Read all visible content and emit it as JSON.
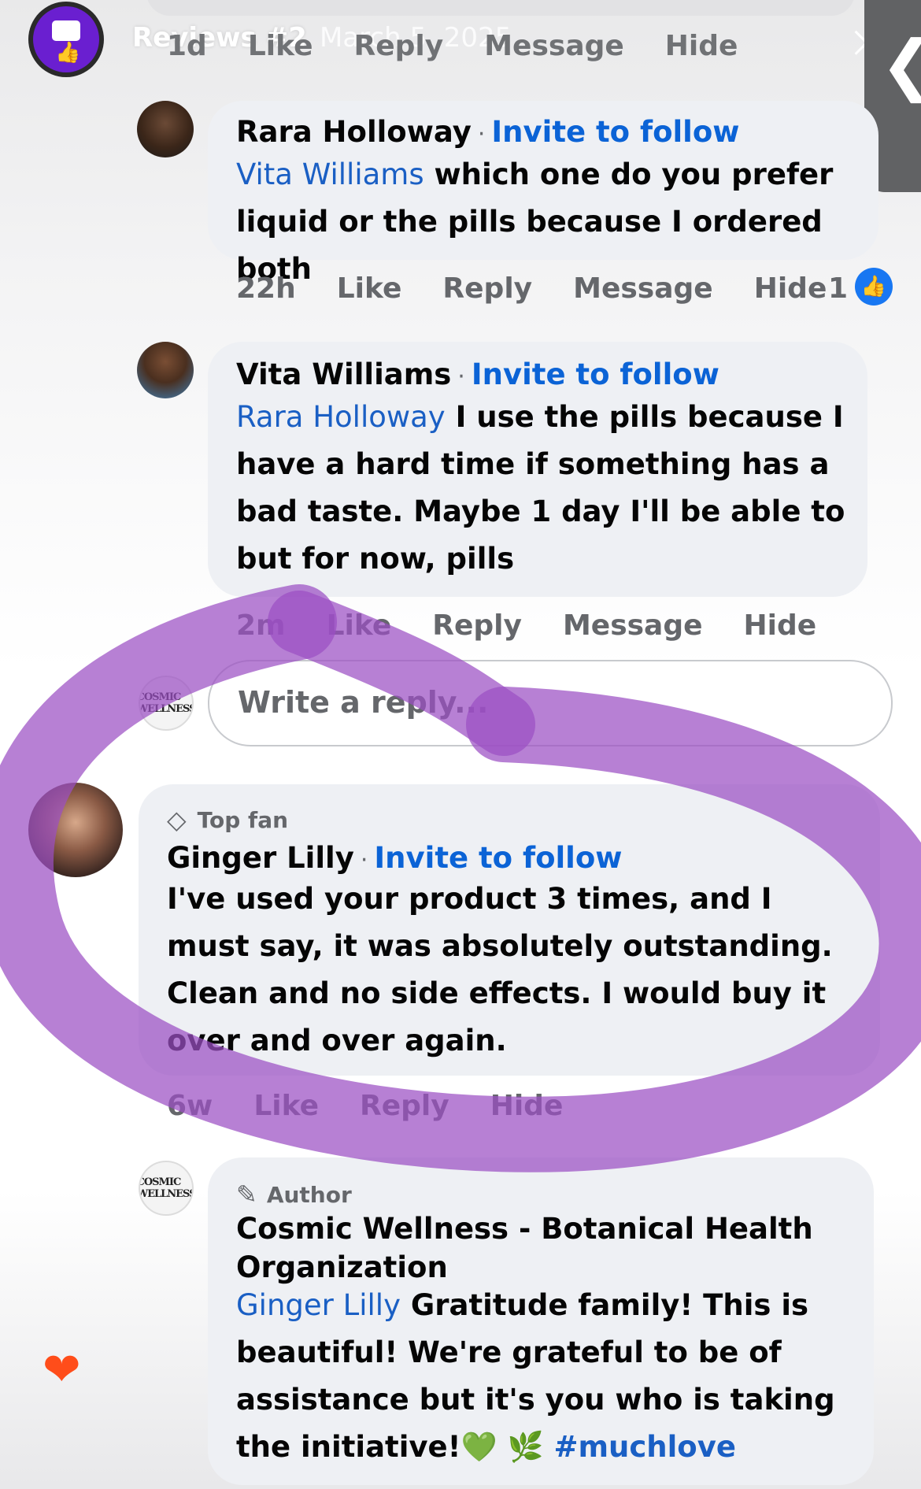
{
  "story": {
    "title": "Reviews #2",
    "date": "March 5, 2025"
  },
  "top_actions": {
    "time": "1d",
    "like": "Like",
    "reply": "Reply",
    "message": "Message",
    "hide": "Hide"
  },
  "comments": [
    {
      "author": "Rara Holloway",
      "invite": "Invite to follow",
      "mention": "Vita Williams",
      "text": " which one do you prefer liquid or the pills because I ordered both",
      "time": "22h",
      "like": "Like",
      "reply": "Reply",
      "message": "Message",
      "hide": "Hide",
      "reaction_count": "1"
    },
    {
      "author": "Vita Williams",
      "invite": "Invite to follow",
      "mention": "Rara Holloway",
      "text": " I use the pills because I have a hard time if something has a bad taste. Maybe 1 day I'll be able to but for now, pills",
      "time": "2m",
      "like": "Like",
      "reply": "Reply",
      "message": "Message",
      "hide": "Hide"
    },
    {
      "badge": "Top fan",
      "author": "Ginger Lilly",
      "invite": "Invite to follow",
      "text": "I've used your product 3 times, and I must say, it was absolutely outstanding. Clean and no side effects. I would buy it over and over again.",
      "time": "6w",
      "like": "Like",
      "reply": "Reply",
      "hide": "Hide"
    },
    {
      "badge": "Author",
      "author": "Cosmic Wellness - Botanical Health Organization",
      "mention": "Ginger Lilly",
      "text": " Gratitude family! This is beautiful! We're grateful to be of assistance but it's you who is taking the initiative!",
      "emoji": "💚 🌿",
      "hashtag": "#muchlove"
    }
  ],
  "reply_box": {
    "placeholder": "Write a reply..."
  },
  "cosmic_logo": "COSMIC WELLNESS",
  "colors": {
    "accent": "#0b63d6",
    "highlight": "#9b4fc4",
    "bubble": "#eef0f4"
  }
}
